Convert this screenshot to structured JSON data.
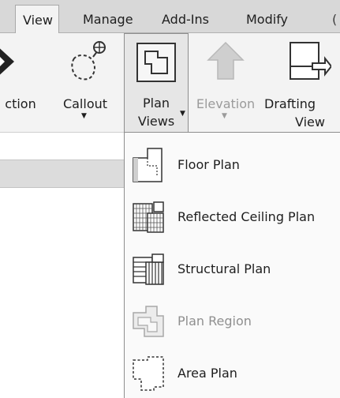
{
  "tabs": [
    {
      "label": "View",
      "active": true
    },
    {
      "label": "Manage",
      "active": false
    },
    {
      "label": "Add-Ins",
      "active": false
    },
    {
      "label": "Modify",
      "active": false
    },
    {
      "label": "(",
      "active": false
    }
  ],
  "ribbon": {
    "section": {
      "label": "ction"
    },
    "callout": {
      "label": "Callout"
    },
    "plan_views": {
      "line1": "Plan",
      "line2": "Views"
    },
    "elevation": {
      "label": "Elevation",
      "enabled": false
    },
    "drafting_view": {
      "line1": "Drafting",
      "line2": "View"
    }
  },
  "menu": {
    "items": [
      {
        "label": "Floor Plan",
        "icon": "floor-plan-icon",
        "enabled": true
      },
      {
        "label": "Reflected Ceiling Plan",
        "icon": "reflected-ceiling-plan-icon",
        "enabled": true
      },
      {
        "label": "Structural Plan",
        "icon": "structural-plan-icon",
        "enabled": true
      },
      {
        "label": "Plan Region",
        "icon": "plan-region-icon",
        "enabled": false
      },
      {
        "label": "Area Plan",
        "icon": "area-plan-icon",
        "enabled": true
      }
    ]
  },
  "colors": {
    "tab_bar": "#d8d8d8",
    "ribbon": "#f3f3f3",
    "pressed_button": "#e6e6e6",
    "disabled_text": "#9b9b9b",
    "menu_bg": "#fafafa"
  }
}
